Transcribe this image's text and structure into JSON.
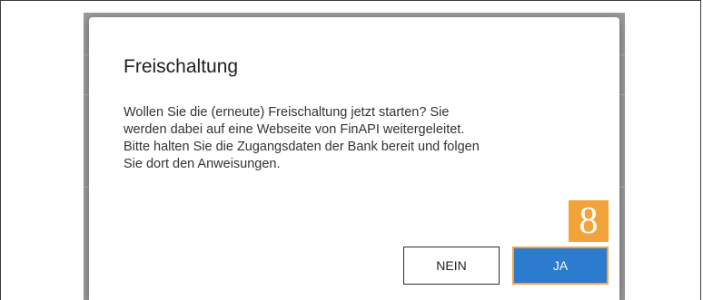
{
  "dialog": {
    "title": "Freischaltung",
    "body_lines": [
      "Wollen Sie die (erneute) Freischaltung jetzt starten? Sie",
      "werden dabei auf eine Webseite von FinAPI weitergeleitet.",
      "Bitte halten Sie die Zugangsdaten der Bank bereit und folgen",
      "Sie dort den Anweisungen."
    ],
    "no_label": "NEIN",
    "yes_label": "JA"
  },
  "callout": {
    "number": "8"
  },
  "colors": {
    "accent_blue": "#2b7bcf",
    "callout_orange": "#f2a33a",
    "overlay_gray": "#9a9a9a"
  }
}
